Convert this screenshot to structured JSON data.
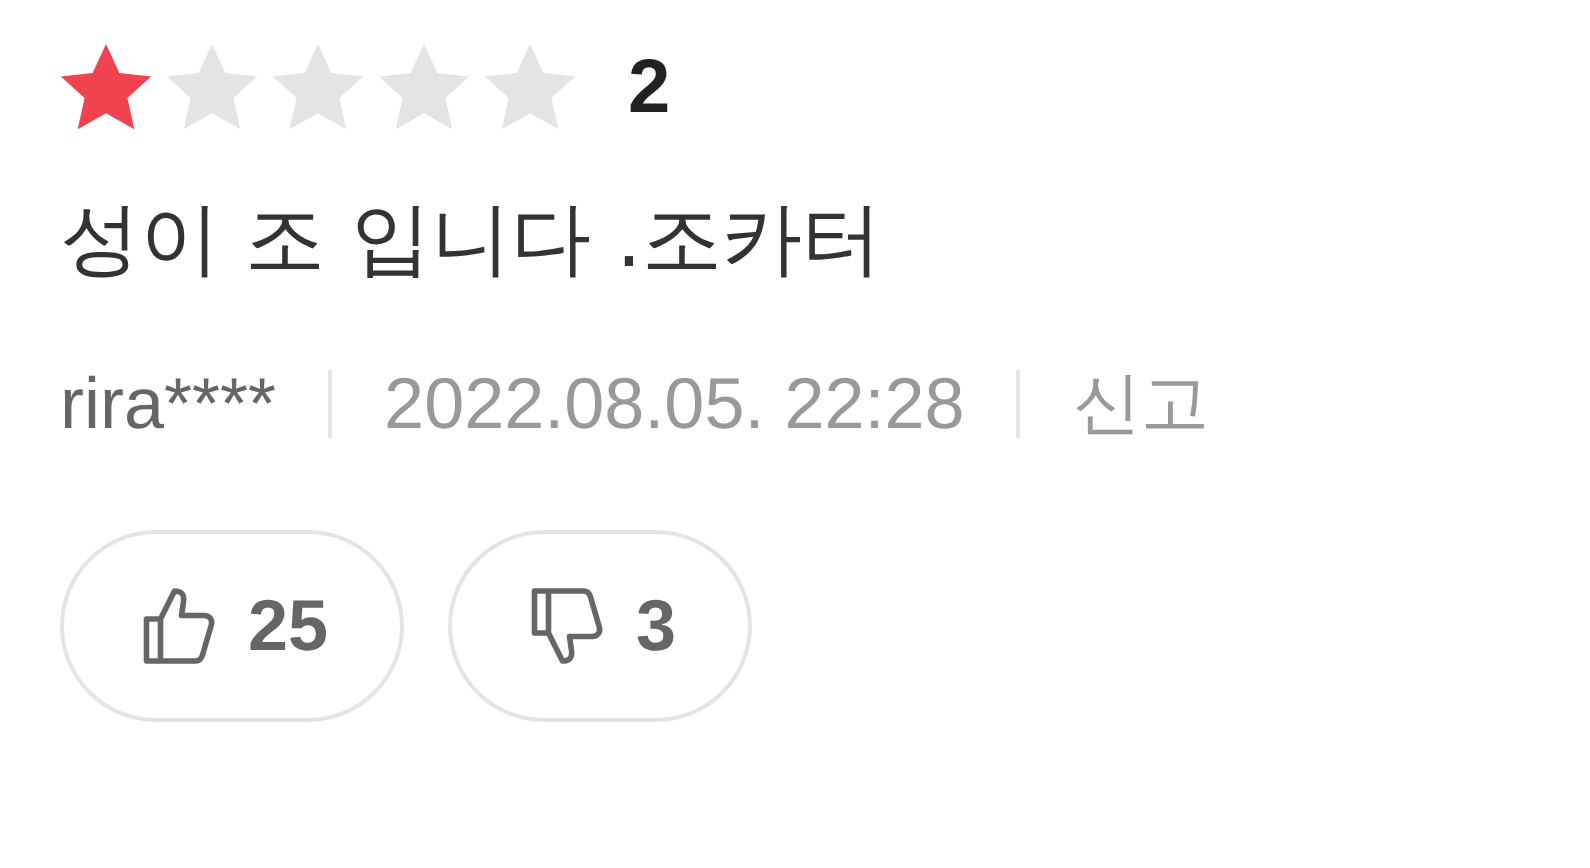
{
  "review": {
    "stars": 1,
    "score": "2",
    "text": "성이 조 입니다 .조카터",
    "author": "rira****",
    "date": "2022.08.05. 22:28",
    "report": "신고"
  },
  "votes": [
    {
      "kind": "like",
      "count": "25"
    },
    {
      "kind": "dislike",
      "count": "3"
    }
  ]
}
